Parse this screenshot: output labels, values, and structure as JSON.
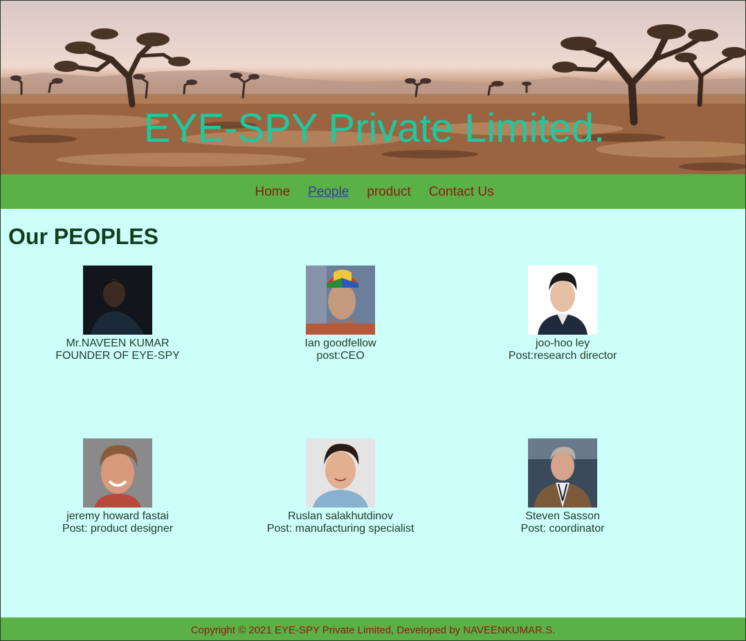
{
  "header": {
    "title": "EYE-SPY Private Limited."
  },
  "nav": {
    "items": [
      {
        "label": "Home",
        "active": false
      },
      {
        "label": "People",
        "active": true
      },
      {
        "label": "product",
        "active": false
      },
      {
        "label": "Contact Us",
        "active": false
      }
    ]
  },
  "main": {
    "title": "Our PEOPLES",
    "people": [
      {
        "name": "Mr.NAVEEN KUMAR",
        "role": "FOUNDER OF EYE-SPY"
      },
      {
        "name": "Ian goodfellow",
        "role": "post:CEO"
      },
      {
        "name": "joo-hoo ley",
        "role": "Post:research director"
      },
      {
        "name": "jeremy howard fastai",
        "role": "Post: product designer"
      },
      {
        "name": "Ruslan salakhutdinov",
        "role": "Post: manufacturing specialist"
      },
      {
        "name": "Steven Sasson",
        "role": "Post: coordinator"
      }
    ]
  },
  "footer": {
    "text": "Copyright © 2021 EYE-SPY Private Limited, Developed by NAVEENKUMAR.S."
  },
  "colors": {
    "nav_bg": "#5ab146",
    "page_bg": "#ccfffa",
    "title_teal": "#1ec8a0",
    "link_red": "#8b1a10",
    "link_active": "#3a3f8f"
  }
}
